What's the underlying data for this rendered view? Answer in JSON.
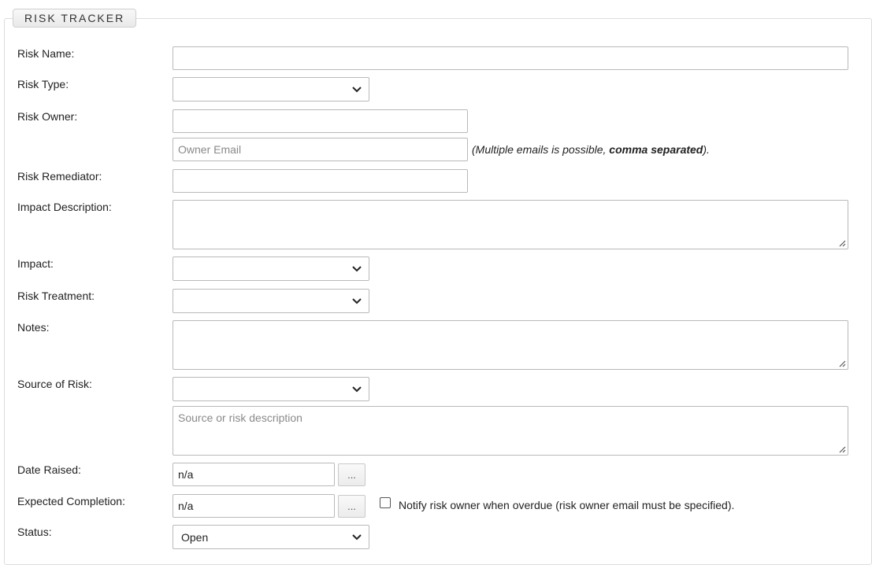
{
  "panel": {
    "title": "RISK TRACKER"
  },
  "form": {
    "risk_name_label": "Risk Name:",
    "risk_type_label": "Risk Type:",
    "risk_owner_label": "Risk Owner:",
    "owner_email_placeholder": "Owner Email",
    "owner_email_hint_prefix": "(Multiple emails is possible, ",
    "owner_email_hint_bold": "comma separated",
    "owner_email_hint_suffix": ").",
    "risk_remediator_label": "Risk Remediator:",
    "impact_description_label": "Impact Description:",
    "impact_label": "Impact:",
    "risk_treatment_label": "Risk Treatment:",
    "notes_label": "Notes:",
    "source_of_risk_label": "Source of Risk:",
    "source_description_placeholder": "Source or risk description",
    "date_raised_label": "Date Raised:",
    "date_raised_value": "n/a",
    "date_picker_label": "...",
    "expected_completion_label": "Expected Completion:",
    "expected_completion_value": "n/a",
    "notify_label": "Notify risk owner when overdue (risk owner email must be specified).",
    "notify_checked": false,
    "status_label": "Status:",
    "status_value": "Open"
  },
  "icons": {
    "select_arrow": "chevron-down-icon",
    "resize_grip": "resize-grip-icon"
  }
}
